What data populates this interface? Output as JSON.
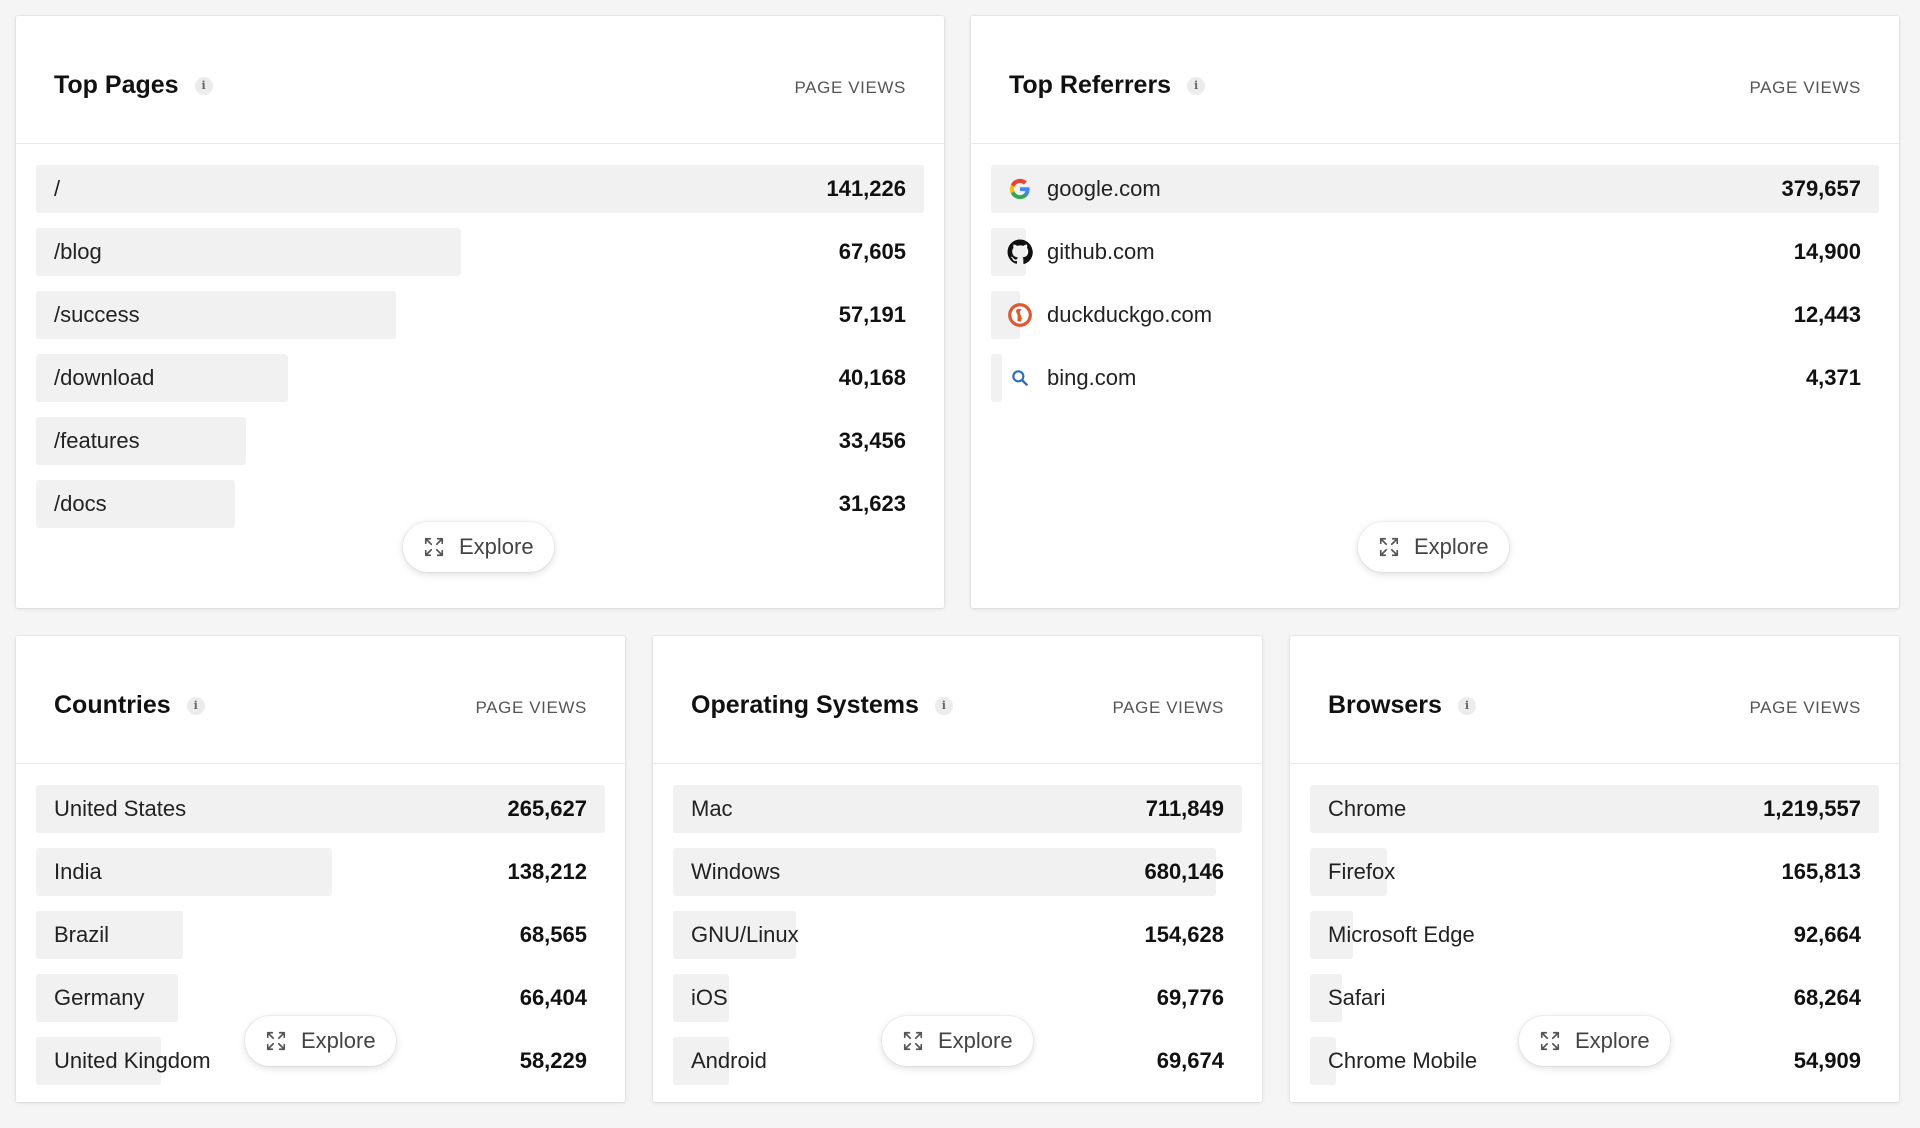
{
  "column_header": "PAGE VIEWS",
  "explore_label": "Explore",
  "accent": {
    "bar": "#f1f1f1",
    "divider": "#e8e8e8"
  },
  "top_pages": {
    "title": "Top Pages",
    "rows": [
      {
        "label": "/",
        "value": "141,226",
        "share": 1.0
      },
      {
        "label": "/blog",
        "value": "67,605",
        "share": 0.479
      },
      {
        "label": "/success",
        "value": "57,191",
        "share": 0.405
      },
      {
        "label": "/download",
        "value": "40,168",
        "share": 0.284
      },
      {
        "label": "/features",
        "value": "33,456",
        "share": 0.237
      },
      {
        "label": "/docs",
        "value": "31,623",
        "share": 0.224
      }
    ]
  },
  "top_referrers": {
    "title": "Top Referrers",
    "rows": [
      {
        "label": "google.com",
        "value": "379,657",
        "share": 1.0,
        "icon": "google-icon"
      },
      {
        "label": "github.com",
        "value": "14,900",
        "share": 0.039,
        "icon": "github-icon"
      },
      {
        "label": "duckduckgo.com",
        "value": "12,443",
        "share": 0.033,
        "icon": "duckduckgo-icon"
      },
      {
        "label": "bing.com",
        "value": "4,371",
        "share": 0.012,
        "icon": "bing-search-icon"
      }
    ]
  },
  "countries": {
    "title": "Countries",
    "rows": [
      {
        "label": "United States",
        "value": "265,627",
        "share": 1.0
      },
      {
        "label": "India",
        "value": "138,212",
        "share": 0.52
      },
      {
        "label": "Brazil",
        "value": "68,565",
        "share": 0.258
      },
      {
        "label": "Germany",
        "value": "66,404",
        "share": 0.25
      },
      {
        "label": "United Kingdom",
        "value": "58,229",
        "share": 0.219
      }
    ]
  },
  "operating_systems": {
    "title": "Operating Systems",
    "rows": [
      {
        "label": "Mac",
        "value": "711,849",
        "share": 1.0
      },
      {
        "label": "Windows",
        "value": "680,146",
        "share": 0.955
      },
      {
        "label": "GNU/Linux",
        "value": "154,628",
        "share": 0.217
      },
      {
        "label": "iOS",
        "value": "69,776",
        "share": 0.098
      },
      {
        "label": "Android",
        "value": "69,674",
        "share": 0.098
      }
    ]
  },
  "browsers": {
    "title": "Browsers",
    "rows": [
      {
        "label": "Chrome",
        "value": "1,219,557",
        "share": 1.0
      },
      {
        "label": "Firefox",
        "value": "165,813",
        "share": 0.136
      },
      {
        "label": "Microsoft Edge",
        "value": "92,664",
        "share": 0.076
      },
      {
        "label": "Safari",
        "value": "68,264",
        "share": 0.056
      },
      {
        "label": "Chrome Mobile",
        "value": "54,909",
        "share": 0.045
      }
    ]
  }
}
